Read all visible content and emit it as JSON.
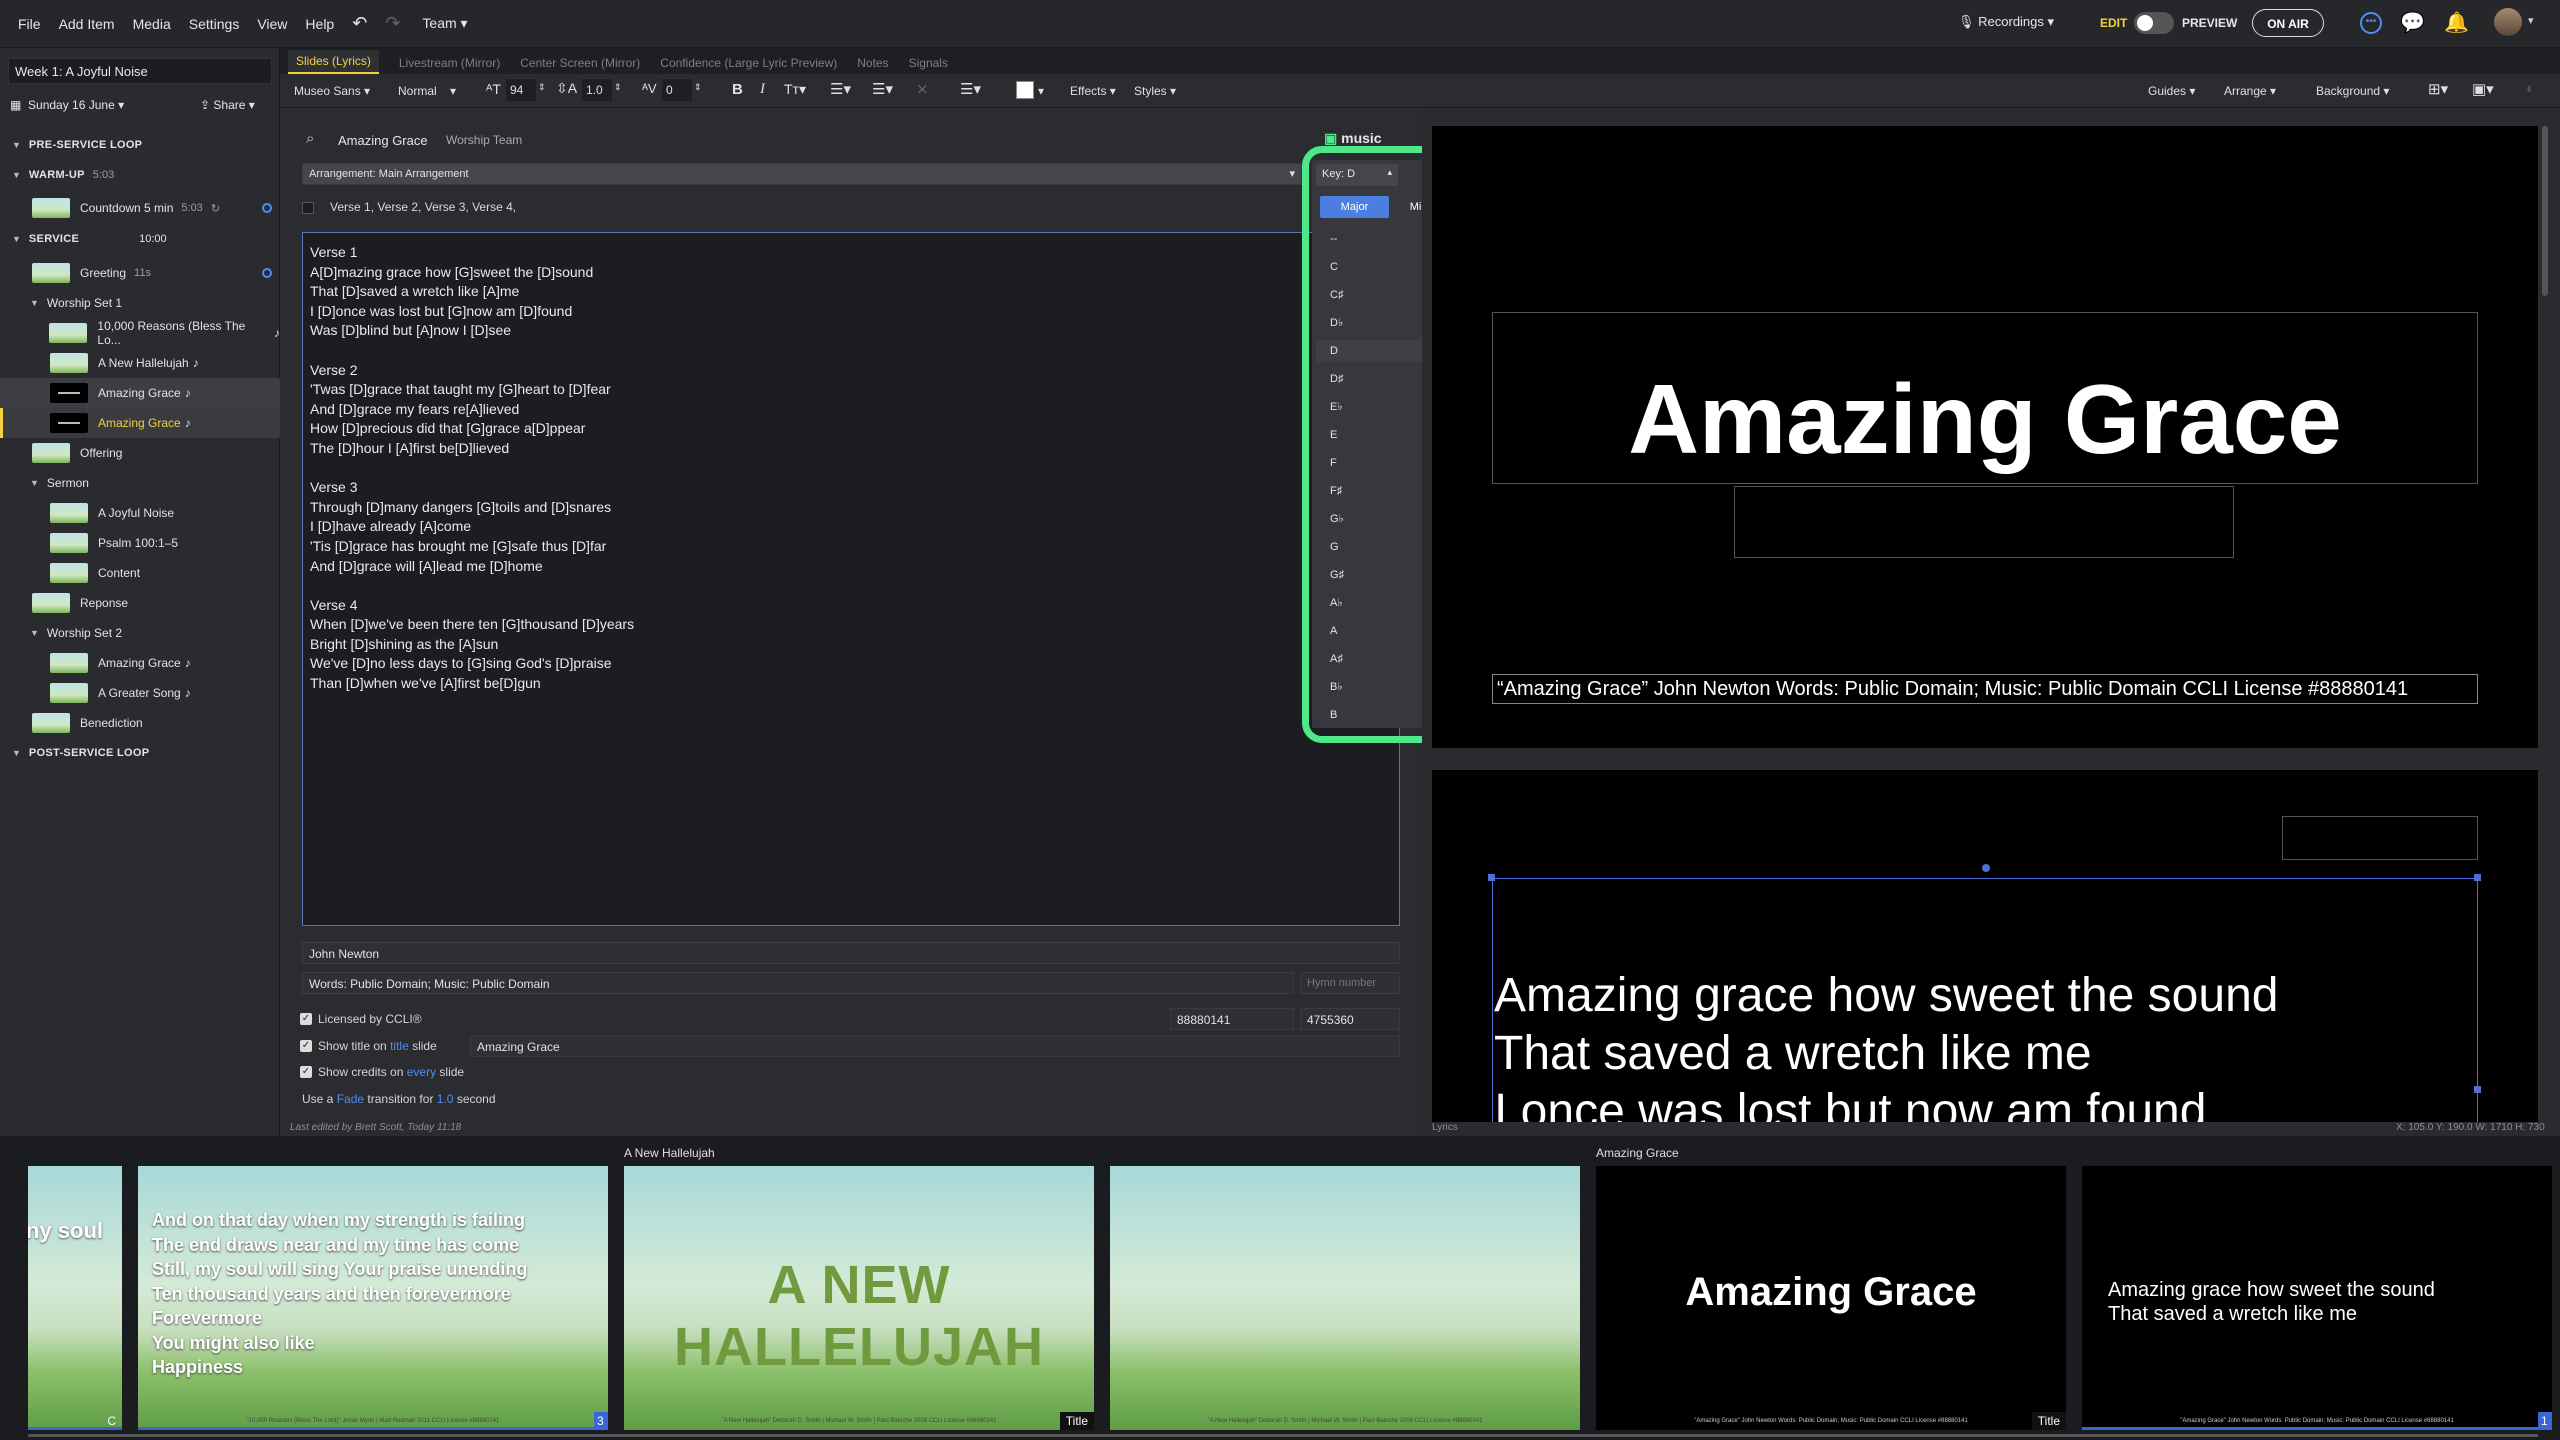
{
  "menu": {
    "items": [
      "File",
      "Add Item",
      "Media",
      "Settings",
      "View",
      "Help"
    ],
    "team": "Team",
    "recordings": "Recordings",
    "edit": "EDIT",
    "preview": "PREVIEW",
    "on_air": "ON AIR"
  },
  "sidebar": {
    "doc_title": "Week 1: A Joyful Noise",
    "date": "Sunday 16 June",
    "share": "Share",
    "sections": {
      "pre_service": "PRE-SERVICE LOOP",
      "warmup": "WARM-UP",
      "warmup_time": "5:03",
      "service": "SERVICE",
      "service_time": "10:00",
      "post_service": "POST-SERVICE LOOP"
    },
    "items": {
      "countdown": "Countdown 5 min",
      "countdown_time": "5:03",
      "greeting": "Greeting",
      "greeting_time": "11s",
      "worship_set_1": "Worship Set 1",
      "ten_thousand": "10,000 Reasons (Bless The Lo...",
      "new_hallelujah": "A New Hallelujah",
      "amazing_grace_1": "Amazing Grace",
      "amazing_grace_2": "Amazing Grace",
      "offering": "Offering",
      "sermon": "Sermon",
      "joyful_noise": "A Joyful Noise",
      "psalm": "Psalm 100:1–5",
      "content": "Content",
      "reponse": "Reponse",
      "worship_set_2": "Worship Set 2",
      "amazing_grace_3": "Amazing Grace",
      "greater_song": "A Greater Song",
      "benediction": "Benediction"
    }
  },
  "tabs": [
    "Slides (Lyrics)",
    "Livestream (Mirror)",
    "Center Screen (Mirror)",
    "Confidence (Large Lyric Preview)",
    "Notes",
    "Signals"
  ],
  "toolbar": {
    "font": "Museo Sans",
    "weight": "Normal",
    "size": "94",
    "line_height": "1.0",
    "spacing": "0",
    "effects": "Effects",
    "styles": "Styles",
    "guides": "Guides",
    "arrange": "Arrange",
    "background": "Background"
  },
  "editor": {
    "song_title": "Amazing Grace",
    "song_team": "Worship Team",
    "arrangement": "Arrangement: Main Arrangement",
    "sequence": "Verse 1, Verse 2, Verse 3, Verse 4,",
    "key": "Key: D",
    "lyrics": "Verse 1\nA[D]mazing grace how [G]sweet the [D]sound\nThat [D]saved a wretch like [A]me\nI [D]once was lost but [G]now am [D]found\nWas [D]blind but [A]now I [D]see\n\nVerse 2\n'Twas [D]grace that taught my [G]heart to [D]fear\nAnd [D]grace my fears re[A]lieved\nHow [D]precious did that [G]grace a[D]ppear\nThe [D]hour I [A]first be[D]lieved\n\nVerse 3\nThrough [D]many dangers [G]toils and [D]snares\nI [D]have already [A]come\n'Tis [D]grace has brought me [G]safe thus [D]far\nAnd [D]grace will [A]lead me [D]home\n\nVerse 4\nWhen [D]we've been there ten [G]thousand [D]years\nBright [D]shining as the [A]sun\nWe've [D]no less days to [G]sing God's [D]praise\nThan [D]when we've [A]first be[D]gun",
    "author": "John Newton",
    "copyright": "Words: Public Domain; Music: Public Domain",
    "hymn_placeholder": "Hymn number",
    "ccli_label": "Licensed by CCLI®",
    "ccli_license": "88880141",
    "ccli_song": "4755360",
    "show_title_pre": "Show title on",
    "show_title_link": "title",
    "show_title_post": "slide",
    "title_value": "Amazing Grace",
    "show_credits_pre": "Show credits on",
    "show_credits_link": "every",
    "show_credits_post": "slide",
    "transition_pre": "Use a",
    "transition_link": "Fade",
    "transition_mid": "transition for",
    "transition_value": "1.0",
    "transition_post": "second",
    "last_edited": "Last edited by Brett Scott, Today 11:18",
    "music_label": "music"
  },
  "key_menu": {
    "major": "Major",
    "minor": "Minor",
    "keys": [
      "--",
      "C",
      "C♯",
      "D♭",
      "D",
      "D♯",
      "E♭",
      "E",
      "F",
      "F♯",
      "G♭",
      "G",
      "G♯",
      "A♭",
      "A",
      "A♯",
      "B♭",
      "B"
    ],
    "selected": "D"
  },
  "preview": {
    "title": "Amazing Grace",
    "credits": "“Amazing Grace” John Newton Words: Public Domain; Music: Public Domain CCLI License #88880141",
    "lyric_line_1": "Amazing grace how sweet the sound",
    "lyric_line_2": "That saved a wretch like me",
    "lyric_line_3": "I once was lost but now am found",
    "lyrics_label": "Lyrics",
    "coords": "X: 105.0  Y: 190.0   W: 1710  H: 730"
  },
  "strip": {
    "label_hallelujah": "A New Hallelujah",
    "label_grace": "Amazing Grace",
    "s0_text": "ny soul",
    "s0_badge": "C",
    "s1_text": "And on that day when my strength is failing\nThe end draws near and my time has come\nStill, my soul will sing Your praise unending\nTen thousand years and then forevermore\nForevermore\nYou might also like\nHappiness",
    "s1_cap": "\"10,000 Reasons (Bless The Lord)\" Jonas Myrin | Matt Redman 2011 CCLI License #88880141",
    "s1_badge": "3",
    "s2_text": "A NEW HALLELUJAH",
    "s2_cap": "\"A New Hallelujah\" Deborah D. Smith | Michael W. Smith | Paul Baloche 2008 CCLI License #88880141",
    "s2_badge": "Title",
    "s3_cap": "\"A New Hallelujah\" Deborah D. Smith | Michael W. Smith | Paul Baloche 2008 CCLI License #88880141",
    "s4_title": "Amazing Grace",
    "s4_cap": "\"Amazing Grace\" John Newton Words: Public Domain; Music: Public Domain CCLI License #88880141",
    "s4_badge": "Title",
    "s5_text": "Amazing grace how sweet the sound\nThat saved a wretch like me",
    "s5_cap": "\"Amazing Grace\" John Newton Words: Public Domain; Music: Public Domain CCLI License #88880141",
    "s5_badge": "1"
  }
}
